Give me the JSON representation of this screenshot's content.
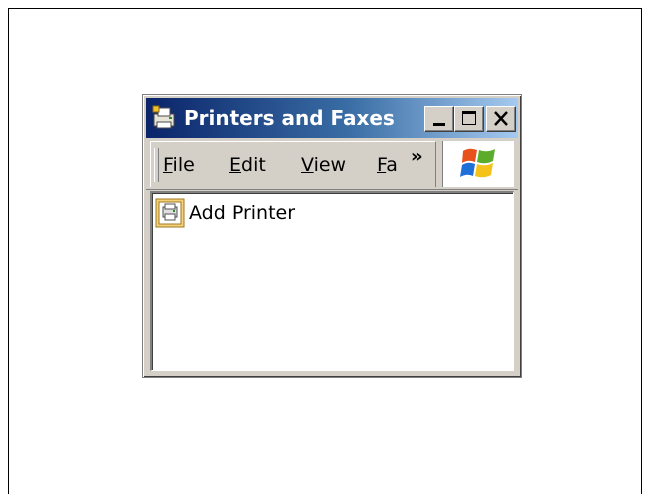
{
  "window": {
    "title": "Printers and Faxes"
  },
  "title_controls": {
    "minimize_icon": "minimize-icon",
    "maximize_icon": "maximize-icon",
    "close_icon": "close-icon"
  },
  "menu": {
    "items": [
      {
        "accel": "F",
        "rest": "ile"
      },
      {
        "accel": "E",
        "rest": "dit"
      },
      {
        "accel": "V",
        "rest": "iew"
      },
      {
        "accel": "F",
        "rest": "a"
      }
    ],
    "overflow": "»"
  },
  "logo": {
    "icon": "windows-logo-icon"
  },
  "content": {
    "items": [
      {
        "label": "Add Printer",
        "icon": "add-printer-icon"
      }
    ]
  },
  "colors": {
    "title_bar_start": "#0a246a",
    "title_bar_end": "#a6caf0",
    "face": "#d4d0c8"
  }
}
